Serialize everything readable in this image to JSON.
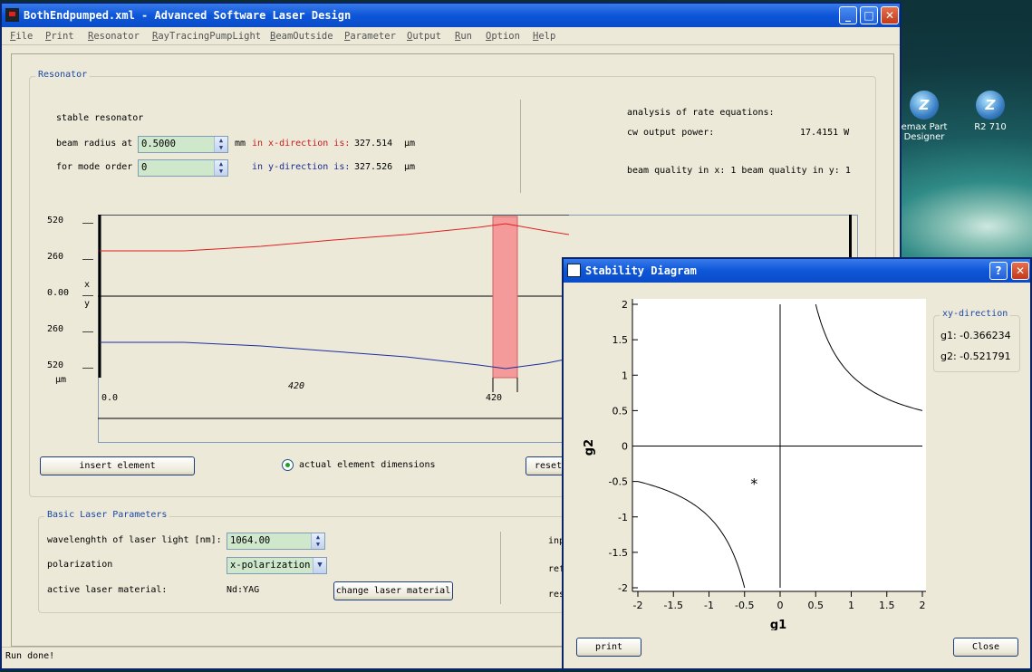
{
  "desktop": {
    "icons": [
      {
        "label1": "emax Part",
        "label2": "Designer",
        "glyph": "Z"
      },
      {
        "label1": "R2 710",
        "label2": "",
        "glyph": "Z"
      }
    ]
  },
  "main": {
    "title": "BothEndpumped.xml - Advanced Software Laser Design",
    "menu": [
      "File",
      "Print",
      "Resonator",
      "RayTracingPumpLight",
      "BeamOutside",
      "Parameter",
      "Output",
      "Run",
      "Option",
      "Help"
    ],
    "resonator": {
      "label": "Resonator",
      "type": "stable resonator",
      "beam_radius_label": "beam radius at",
      "beam_radius_value": "0.5000",
      "unit_mm": "mm",
      "x_dir_label": "in x-direction is:",
      "x_dir_value": "327.514",
      "unit_um": "µm",
      "mode_order_label": "for mode order",
      "mode_order_value": "0",
      "y_dir_label": "in y-direction is:",
      "y_dir_value": "327.526",
      "rate_title": "analysis of rate equations:",
      "cw_label": "cw output power:",
      "cw_value": "17.4151 W",
      "quality": "beam quality in x: 1 beam quality in y: 1",
      "plot": {
        "y_ticks": [
          "520",
          "260",
          "0.00",
          "260",
          "520"
        ],
        "y_unit": "µm",
        "axis_x": "x",
        "axis_y": "y",
        "x_ticks": [
          "0.0",
          "420",
          "420"
        ]
      },
      "insert_btn": "insert element",
      "radio_label": "actual element dimensions",
      "reset_btn": "reset"
    },
    "basic": {
      "label": "Basic Laser Parameters",
      "wavelength_label": "wavelenghth of laser light [nm]:",
      "wavelength_value": "1064.00",
      "polarization_label": "polarization",
      "polarization_value": "x-polarization",
      "material_label": "active laser material:",
      "material_value": "Nd:YAG",
      "change_btn": "change laser material",
      "right_labels": [
        "inp",
        "ref",
        "res"
      ]
    },
    "status": "Run done!"
  },
  "stability": {
    "title": "Stability Diagram",
    "xlabel": "g1",
    "ylabel": "g2",
    "ticks": [
      "-2",
      "-1.5",
      "-1",
      "-0.5",
      "0",
      "0.5",
      "1",
      "1.5",
      "2"
    ],
    "xy_label": "xy-direction",
    "g1_text": "g1: -0.366234",
    "g2_text": "g2: -0.521791",
    "print_btn": "print",
    "close_btn": "Close"
  },
  "chart_data": {
    "type": "scatter",
    "xlabel": "g1",
    "ylabel": "g2",
    "xlim": [
      -2,
      2
    ],
    "ylim": [
      -2,
      2
    ],
    "x": [
      -0.366234
    ],
    "y": [
      -0.521791
    ]
  }
}
